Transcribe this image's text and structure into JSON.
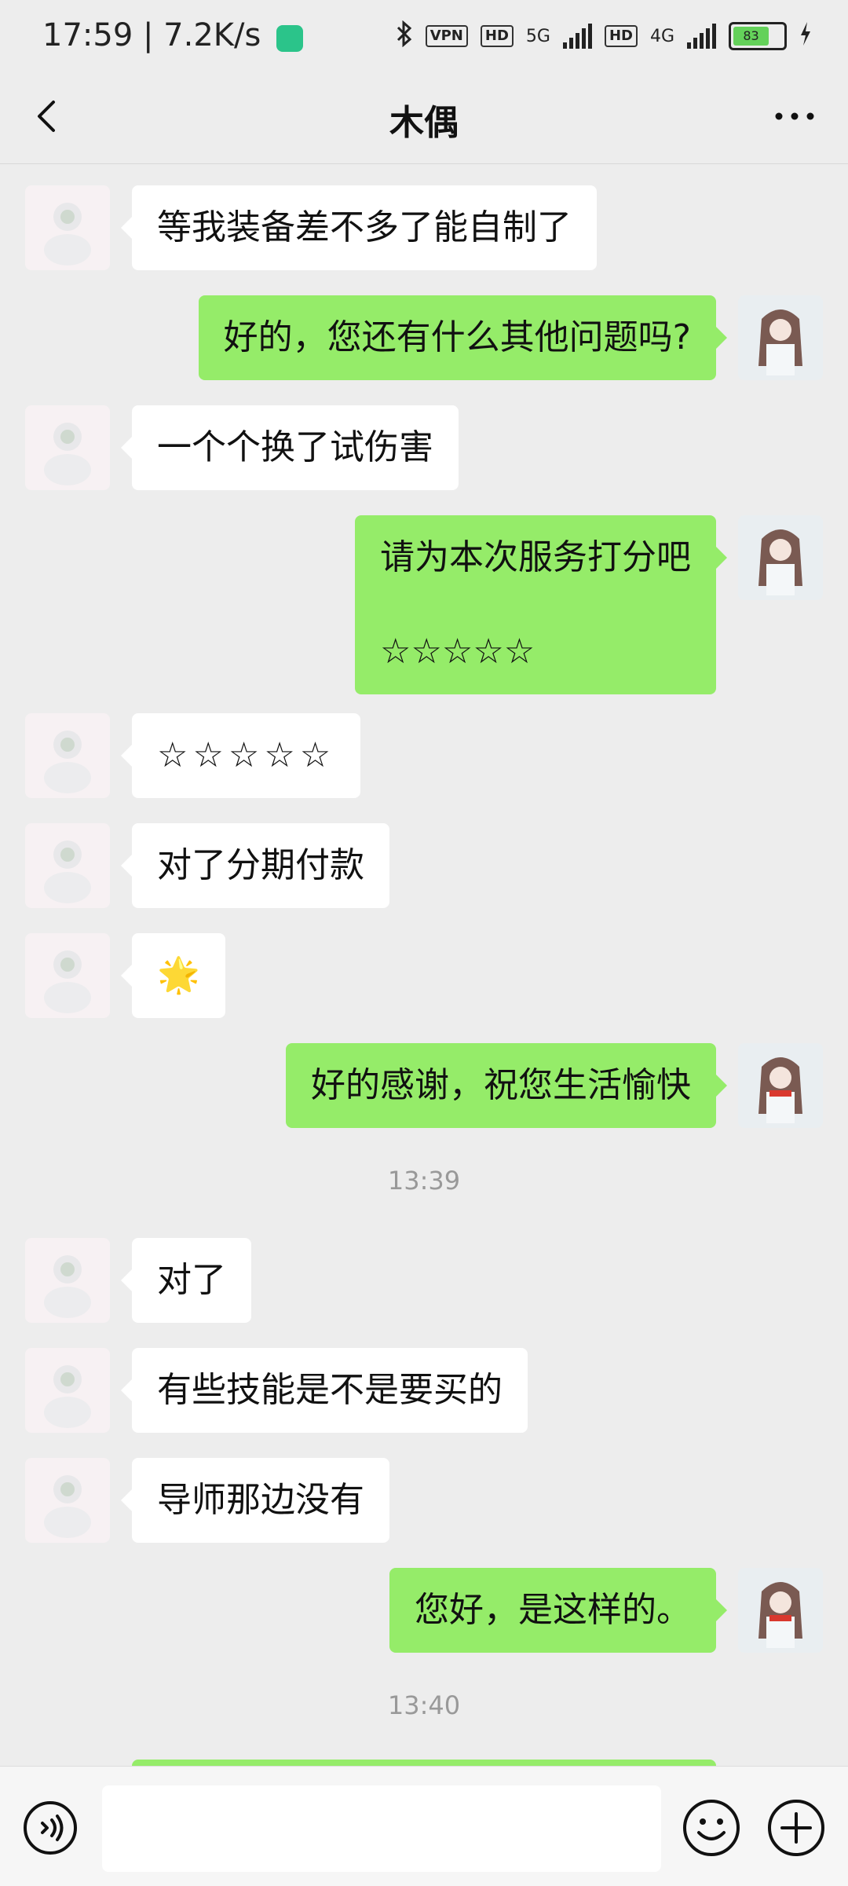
{
  "status_bar": {
    "time": "17:59 | 7.2K/s",
    "vpn": "VPN",
    "hd1": "HD",
    "net1": "5G",
    "hd2": "HD",
    "net2": "4G",
    "battery": "83"
  },
  "header": {
    "title": "木偶"
  },
  "messages": [
    {
      "side": "left",
      "text": "等我装备差不多了能自制了"
    },
    {
      "side": "right",
      "text": "好的，您还有什么其他问题吗?"
    },
    {
      "side": "left",
      "text": "一个个换了试伤害"
    },
    {
      "side": "right",
      "text": "请为本次服务打分吧\n\n☆☆☆☆☆"
    },
    {
      "side": "left",
      "text": "☆☆☆☆☆"
    },
    {
      "side": "left",
      "text": "对了分期付款"
    },
    {
      "side": "left",
      "text": "🌟"
    },
    {
      "side": "right",
      "text": "好的感谢，祝您生活愉快"
    },
    {
      "side": "left",
      "text": "对了"
    },
    {
      "side": "left",
      "text": "有些技能是不是要买的"
    },
    {
      "side": "left",
      "text": "导师那边没有"
    },
    {
      "side": "right",
      "text": "您好，是这样的。"
    }
  ],
  "timestamps": [
    "13:39",
    "13:40"
  ],
  "colors": {
    "self_bubble": "#95ec69",
    "other_bubble": "#ffffff",
    "background": "#ededed"
  }
}
